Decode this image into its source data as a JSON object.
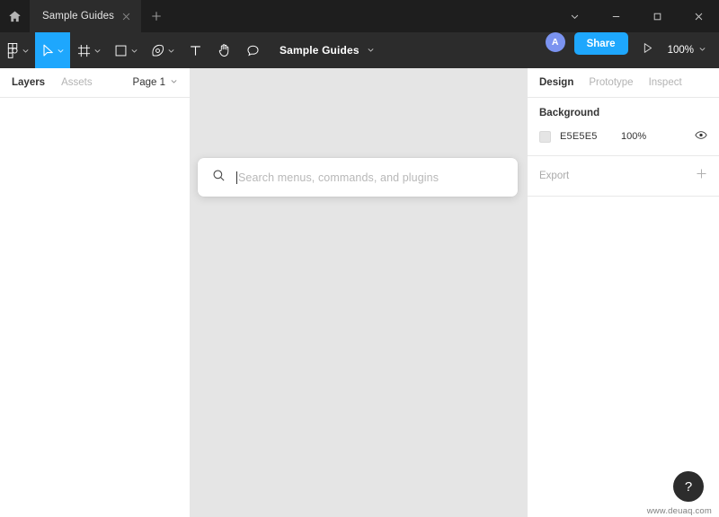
{
  "titlebar": {
    "home_icon": "home-icon",
    "tabs": [
      {
        "label": "Sample Guides",
        "close_icon": "close-icon"
      }
    ],
    "new_tab_icon": "plus-icon",
    "window_controls": [
      {
        "name": "chevron-down-icon",
        "glyph": "chevron-down"
      },
      {
        "name": "minimize-icon",
        "glyph": "minimize"
      },
      {
        "name": "maximize-icon",
        "glyph": "maximize"
      },
      {
        "name": "close-icon",
        "glyph": "close"
      }
    ]
  },
  "toolbar": {
    "tools": [
      {
        "name": "figma-menu",
        "icon": "figma-logo-icon",
        "caret": true,
        "active": false
      },
      {
        "name": "move-tool",
        "icon": "cursor-arrow-icon",
        "caret": true,
        "active": true
      },
      {
        "name": "frame-tool",
        "icon": "frame-icon",
        "caret": true,
        "active": false
      },
      {
        "name": "shape-tool",
        "icon": "rectangle-icon",
        "caret": true,
        "active": false
      },
      {
        "name": "pen-tool",
        "icon": "pen-icon",
        "caret": true,
        "active": false
      },
      {
        "name": "text-tool",
        "icon": "text-icon",
        "caret": false,
        "active": false
      },
      {
        "name": "hand-tool",
        "icon": "hand-icon",
        "caret": false,
        "active": false
      },
      {
        "name": "comment-tool",
        "icon": "comment-icon",
        "caret": false,
        "active": false
      }
    ],
    "document_title": "Sample Guides",
    "document_caret_icon": "chevron-down-icon",
    "avatar_initial": "A",
    "share_label": "Share",
    "present_icon": "play-icon",
    "zoom_level": "100%",
    "zoom_caret_icon": "chevron-down-icon",
    "accent_color": "#1EA7FD",
    "avatar_color": "#7B93F0"
  },
  "left_panel": {
    "tabs": [
      {
        "label": "Layers",
        "active": true
      },
      {
        "label": "Assets",
        "active": false
      }
    ],
    "page_selector": {
      "label": "Page 1",
      "caret_icon": "chevron-down-icon"
    },
    "layers": []
  },
  "right_panel": {
    "tabs": [
      {
        "label": "Design",
        "active": true
      },
      {
        "label": "Prototype",
        "active": false
      },
      {
        "label": "Inspect",
        "active": false
      }
    ],
    "background": {
      "title": "Background",
      "swatch_color": "#E5E5E5",
      "hex": "E5E5E5",
      "opacity": "100%",
      "visibility_icon": "eye-icon"
    },
    "export": {
      "label": "Export",
      "add_icon": "plus-icon"
    }
  },
  "canvas": {
    "background_color": "#E5E5E5"
  },
  "quick_search": {
    "search_icon": "search-icon",
    "value": "",
    "placeholder": "Search menus, commands, and plugins"
  },
  "help_button": {
    "label": "?",
    "name": "help-button"
  },
  "watermark": {
    "text": "www.deuaq.com"
  }
}
